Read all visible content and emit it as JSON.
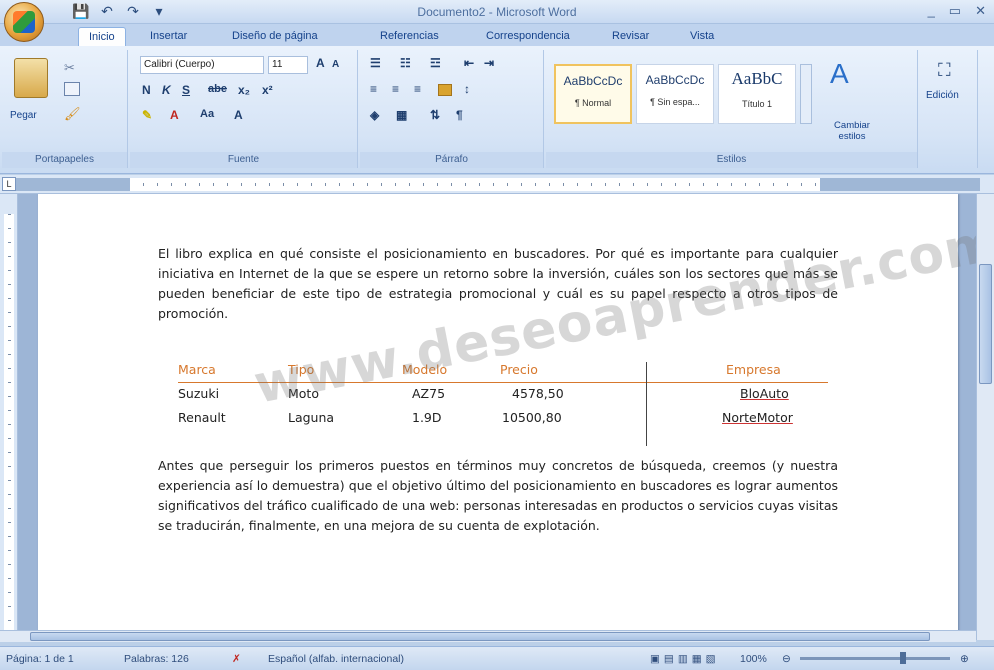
{
  "window": {
    "title": "Documento2 - Microsoft Word",
    "controls": [
      "_",
      "▭",
      "✕"
    ]
  },
  "quick_access": [
    "save-icon",
    "undo-icon",
    "redo-icon",
    "customize-icon"
  ],
  "tabs": [
    {
      "label": "Inicio",
      "active": true
    },
    {
      "label": "Insertar"
    },
    {
      "label": "Diseño de página"
    },
    {
      "label": "Referencias"
    },
    {
      "label": "Correspondencia"
    },
    {
      "label": "Revisar"
    },
    {
      "label": "Vista"
    }
  ],
  "ribbon": {
    "clipboard": {
      "label": "Portapapeles",
      "paste_label": "Pegar"
    },
    "font": {
      "label": "Fuente",
      "font_name": "Calibri (Cuerpo)",
      "font_size": "11",
      "bold": "N",
      "italic": "K",
      "underline": "S",
      "strike": "abe",
      "sub": "x₂",
      "sup": "x²",
      "case": "Aa",
      "grow": "A",
      "shrink": "A"
    },
    "paragraph": {
      "label": "Párrafo"
    },
    "styles": {
      "label": "Estilos",
      "items": [
        {
          "sample": "AaBbCcDc",
          "name": "¶ Normal"
        },
        {
          "sample": "AaBbCcDc",
          "name": "¶ Sin espa..."
        },
        {
          "sample": "AaBbC",
          "name": "Título 1"
        }
      ],
      "change_label": "Cambiar estilos"
    },
    "editing": {
      "label": "Edición"
    }
  },
  "document": {
    "paragraph1": "El libro explica en qué consiste el posicionamiento en buscadores. Por qué es importante para cualquier iniciativa en Internet de la que se espere un retorno sobre la inversión, cuáles son los sectores que más se pueden beneficiar de este tipo de estrategia promocional y cuál es su papel respecto a otros tipos de promoción.",
    "table": {
      "headers": [
        "Marca",
        "Tipo",
        "Modelo",
        "Precio",
        "Empresa"
      ],
      "rows": [
        [
          "Suzuki",
          "Moto",
          "AZ75",
          "4578,50",
          "BloAuto"
        ],
        [
          "Renault",
          "Laguna",
          "1.9D",
          "10500,80",
          "NorteMotor"
        ]
      ]
    },
    "paragraph2": "Antes que perseguir los primeros puestos en términos muy concretos de búsqueda, creemos (y nuestra experiencia así lo demuestra) que el objetivo último del posicionamiento en buscadores es lograr aumentos significativos del tráfico cualificado de una web: personas interesadas en productos o servicios cuyas visitas se traducirán, finalmente, en una mejora de su cuenta de explotación.",
    "watermark": "www.deseoaprender.com"
  },
  "status": {
    "page": "Página: 1 de 1",
    "words": "Palabras: 126",
    "language": "Español (alfab. internacional)",
    "zoom": "100%"
  },
  "colors": {
    "accent": "#d7782d",
    "ribbon": "#d6e4f6",
    "title": "#4d6f9f"
  }
}
